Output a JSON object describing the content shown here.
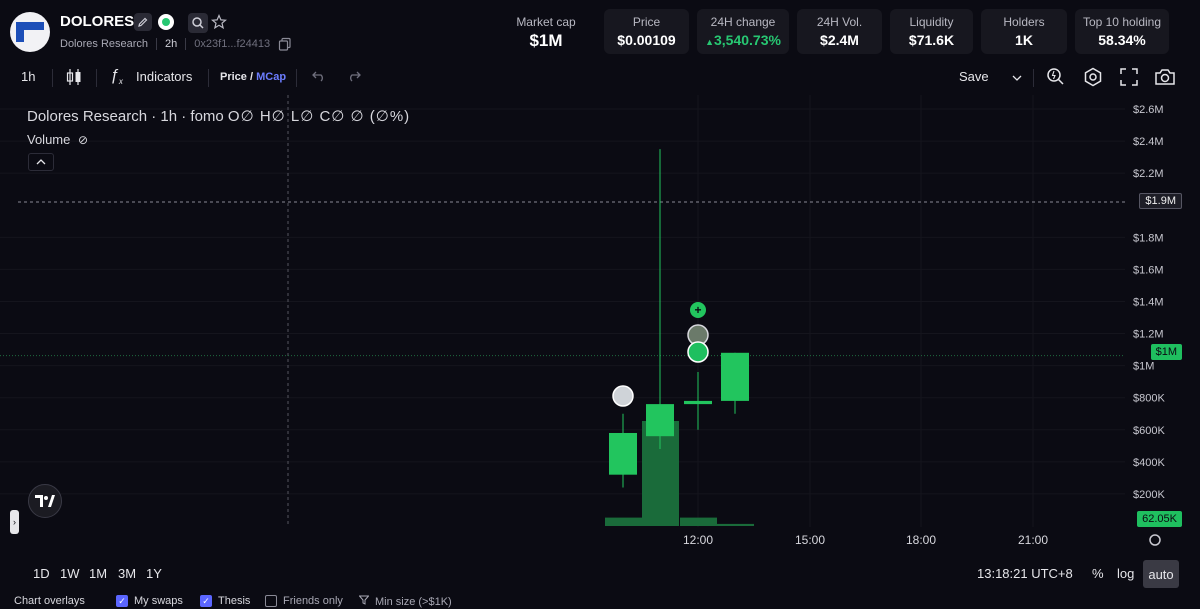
{
  "token": {
    "name": "DOLORES",
    "subtitle": "Dolores Research",
    "age": "2h",
    "address": "0x23f1...f24413"
  },
  "stats": [
    {
      "label": "Market cap",
      "value": "$1M"
    },
    {
      "label": "Price",
      "value": "$0.00109"
    },
    {
      "label": "24H change",
      "value": "3,540.73%",
      "direction": "up",
      "color": "#27c772"
    },
    {
      "label": "24H Vol.",
      "value": "$2.4M"
    },
    {
      "label": "Liquidity",
      "value": "$71.6K"
    },
    {
      "label": "Holders",
      "value": "1K"
    },
    {
      "label": "Top 10 holding",
      "value": "58.34%"
    }
  ],
  "toolbar": {
    "interval": "1h",
    "indicators_label": "Indicators",
    "price_label": "Price",
    "slash": "/",
    "mcap_label": "MCap",
    "save_label": "Save"
  },
  "legend": {
    "title": "Dolores Research · 1h · fomo",
    "ohlc": "O∅ H∅ L∅ C∅ ∅ (∅%)",
    "volume_label": "Volume"
  },
  "chart_data": {
    "type": "candlestick",
    "y_tick_labels": [
      "$2.6M",
      "$2.4M",
      "$2.2M",
      "$1.8M",
      "$1.6M",
      "$1.4M",
      "$1.2M",
      "$1M",
      "$800K",
      "$600K",
      "$400K",
      "$200K"
    ],
    "y_ticks": [
      2600000,
      2400000,
      2200000,
      1800000,
      1600000,
      1400000,
      1200000,
      1000000,
      800000,
      600000,
      400000,
      200000
    ],
    "x_tick_labels": [
      "12:00",
      "15:00",
      "18:00",
      "21:00"
    ],
    "ylim": [
      0,
      2650000
    ],
    "candles": [
      {
        "time": "10:00",
        "open": 320000,
        "high": 700000,
        "low": 240000,
        "close": 580000
      },
      {
        "time": "11:00",
        "open": 560000,
        "high": 2350000,
        "low": 480000,
        "close": 760000
      },
      {
        "time": "12:00",
        "open": 760000,
        "high": 960000,
        "low": 600000,
        "close": 780000
      },
      {
        "time": "13:00",
        "open": 780000,
        "high": 1080000,
        "low": 700000,
        "close": 1080000
      }
    ],
    "volume": [
      {
        "time": "10:00",
        "relative": 0.08
      },
      {
        "time": "11:00",
        "relative": 1.0
      },
      {
        "time": "12:00",
        "relative": 0.08
      },
      {
        "time": "13:00",
        "relative": 0.02
      }
    ],
    "crosshair_label": "$1.9M",
    "current_label": "$1M",
    "low_label": "62.05K",
    "colors": {
      "up": "#22c55e",
      "volume": "#1a6b3a",
      "background": "#0b0b13"
    }
  },
  "bottom": {
    "ranges": [
      "1D",
      "1W",
      "1M",
      "3M",
      "1Y"
    ],
    "time": "13:18:21 UTC+8",
    "percent": "%",
    "log": "log",
    "auto": "auto"
  },
  "overlays": {
    "title": "Chart overlays",
    "my_swaps": "My swaps",
    "thesis": "Thesis",
    "friends_only": "Friends only",
    "min_size": "Min size (>$1K)"
  }
}
